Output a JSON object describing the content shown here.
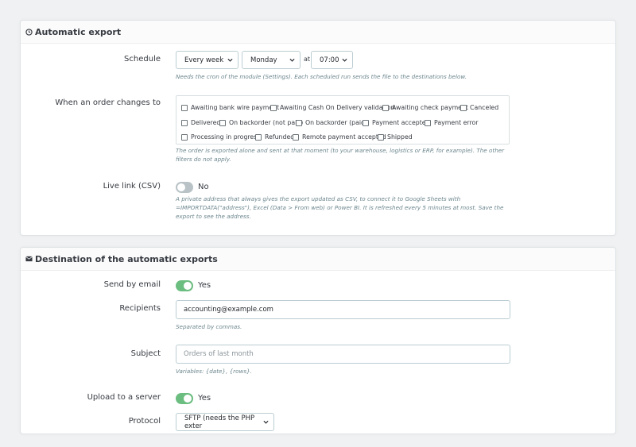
{
  "automatic_export": {
    "title": "Automatic export",
    "schedule": {
      "label": "Schedule",
      "frequency": "Every week",
      "day": "Monday",
      "at_label": "at",
      "time": "07:00",
      "help": "Needs the cron of the module (Settings). Each scheduled run sends the file to the destinations below."
    },
    "order_changes": {
      "label": "When an order changes to",
      "statuses": [
        "Awaiting bank wire payment",
        "Awaiting Cash On Delivery validation",
        "Awaiting check payment",
        "Canceled",
        "Delivered",
        "On backorder (not paid)",
        "On backorder (paid)",
        "Payment accepted",
        "Payment error",
        "Processing in progress",
        "Refunded",
        "Remote payment accepted",
        "Shipped"
      ],
      "help": "The order is exported alone and sent at that moment (to your warehouse, logistics or ERP, for example). The other filters do not apply."
    },
    "live_link": {
      "label": "Live link (CSV)",
      "state": "No",
      "help": "A private address that always gives the export updated as CSV, to connect it to Google Sheets with =IMPORTDATA(\"address\"), Excel (Data > From web) or Power BI. It is refreshed every 5 minutes at most. Save the export to see the address."
    }
  },
  "destination": {
    "title": "Destination of the automatic exports",
    "send_by_email": {
      "label": "Send by email",
      "state": "Yes"
    },
    "recipients": {
      "label": "Recipients",
      "value": "accounting@example.com",
      "help": "Separated by commas."
    },
    "subject": {
      "label": "Subject",
      "placeholder": "Orders of last month",
      "help": "Variables: {date}, {rows}."
    },
    "upload": {
      "label": "Upload to a server",
      "state": "Yes"
    },
    "protocol": {
      "label": "Protocol",
      "value": "SFTP (needs the PHP exter"
    }
  },
  "colors": {
    "toggle_on": "#6cbd80",
    "toggle_off": "#b9c3c7",
    "help_text": "#6c868e"
  },
  "icons": {
    "automatic_export": "clock-icon",
    "destination": "envelope-icon"
  }
}
